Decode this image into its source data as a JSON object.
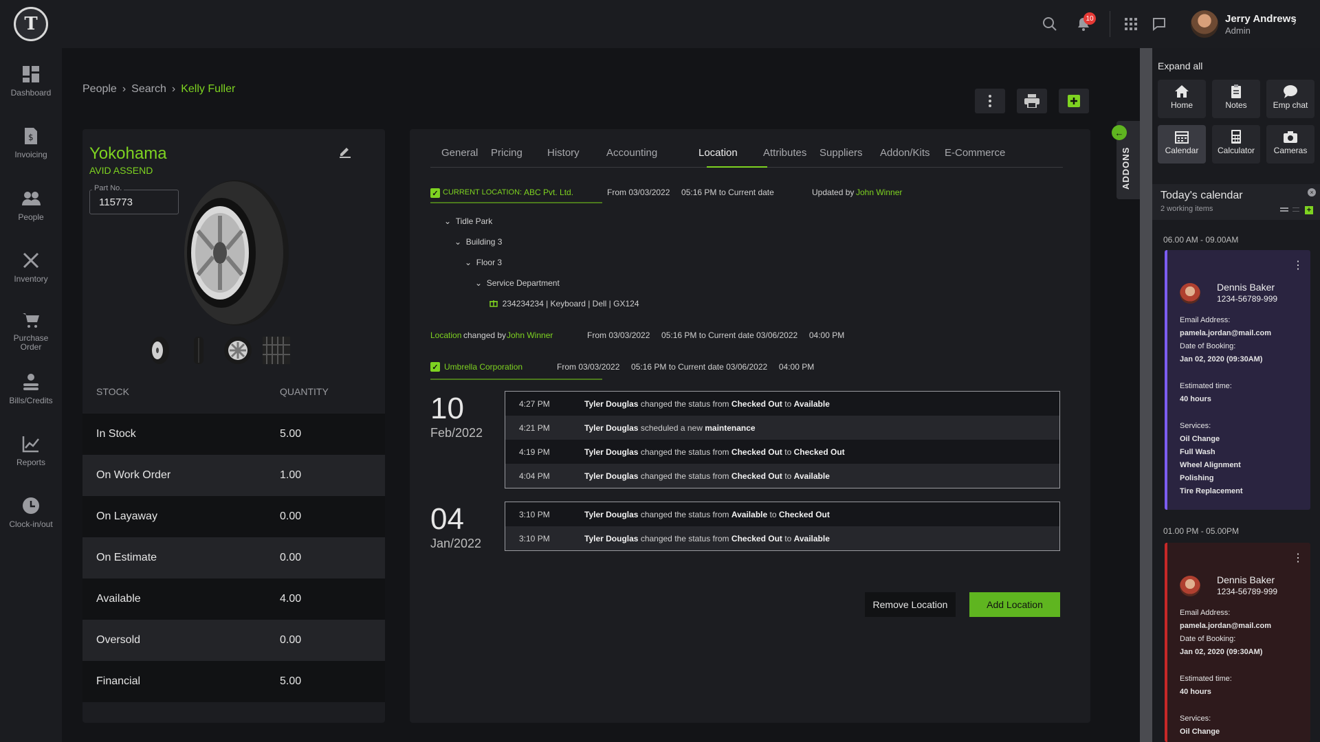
{
  "header": {
    "logo_text": "T",
    "notification_count": "10",
    "user": {
      "name": "Jerry Andrews",
      "role": "Admin"
    }
  },
  "sidebar": {
    "items": [
      {
        "label": "Dashboard",
        "icon": "dashboard-icon"
      },
      {
        "label": "Invoicing",
        "icon": "invoice-icon"
      },
      {
        "label": "People",
        "icon": "people-icon"
      },
      {
        "label": "Inventory",
        "icon": "tools-icon"
      },
      {
        "label": "Purchase Order",
        "icon": "cart-icon"
      },
      {
        "label": "Bills/Credits",
        "icon": "bills-icon"
      },
      {
        "label": "Reports",
        "icon": "chart-icon"
      },
      {
        "label": "Clock-in/out",
        "icon": "clock-icon"
      }
    ]
  },
  "breadcrumb": {
    "items": [
      "People",
      "Search",
      "Kelly Fuller"
    ]
  },
  "product": {
    "brand": "Yokohama",
    "model": "AVID ASSEND",
    "part_label": "Part No.",
    "part_no": "115773"
  },
  "stock": {
    "headers": {
      "stock": "STOCK",
      "quantity": "QUANTITY"
    },
    "rows": [
      {
        "label": "In Stock",
        "value": "5.00"
      },
      {
        "label": "On Work Order",
        "value": "1.00"
      },
      {
        "label": "On Layaway",
        "value": "0.00"
      },
      {
        "label": "On Estimate",
        "value": "0.00"
      },
      {
        "label": "Available",
        "value": "4.00"
      },
      {
        "label": "Oversold",
        "value": "0.00"
      },
      {
        "label": "Financial",
        "value": "5.00"
      }
    ]
  },
  "tabs": [
    "General",
    "Pricing",
    "History",
    "Accounting",
    "Location",
    "Attributes",
    "Suppliers",
    "Addon/Kits",
    "E-Commerce"
  ],
  "location": {
    "current_label": "CURRENT LOCATION:",
    "current_value": "ABC Pvt. Ltd.",
    "current_range": "From 03/03/2022     05:16 PM to Current date",
    "updated_prefix": "Updated by",
    "updated_by": "John Winner",
    "tree": [
      "Tidle Park",
      "Building 3",
      "Floor 3",
      "Service Department",
      "234234234 | Keyboard | Dell | GX124"
    ],
    "changed_link": "Location",
    "changed_mid": "changed by",
    "changed_by": "John Winner",
    "changed_range": "From 03/03/2022     05:16 PM to Current date 03/06/2022     04:00 PM",
    "second_name": "Umbrella Corporation",
    "second_range": "From 03/03/2022     05:16 PM to Current date 03/06/2022     04:00 PM"
  },
  "log_groups": [
    {
      "day": "10",
      "month": "Feb/2022",
      "rows": [
        {
          "time": "4:27 PM",
          "who": "Tyler Douglas",
          "mid": "changed the status from",
          "from": "Checked Out",
          "to_word": "to",
          "to": "Available"
        },
        {
          "time": "4:21 PM",
          "who": "Tyler Douglas",
          "mid": "scheduled a new",
          "from": "maintenance",
          "to_word": "",
          "to": ""
        },
        {
          "time": "4:19 PM",
          "who": "Tyler Douglas",
          "mid": "changed the status from",
          "from": "Checked Out",
          "to_word": "to",
          "to": "Checked Out"
        },
        {
          "time": "4:04 PM",
          "who": "Tyler Douglas",
          "mid": "changed the status from",
          "from": "Checked Out",
          "to_word": "to",
          "to": "Available"
        }
      ]
    },
    {
      "day": "04",
      "month": "Jan/2022",
      "rows": [
        {
          "time": "3:10 PM",
          "who": "Tyler Douglas",
          "mid": "changed the status from",
          "from": "Available",
          "to_word": "to",
          "to": "Checked Out"
        },
        {
          "time": "3:10 PM",
          "who": "Tyler Douglas",
          "mid": "changed the status from",
          "from": "Checked Out",
          "to_word": "to",
          "to": "Available"
        }
      ]
    }
  ],
  "buttons": {
    "remove": "Remove Location",
    "add": "Add Location"
  },
  "addons": {
    "tab_label": "ADDONS",
    "expand": "Expand all",
    "quick": [
      "Home",
      "Notes",
      "Emp chat",
      "Calendar",
      "Calculator",
      "Cameras"
    ],
    "calendar_title": "Today's calendar",
    "calendar_sub": "2 working items",
    "slots": [
      {
        "time": "06.00 AM - 09.00AM",
        "name": "Dennis Baker",
        "phone": "1234-56789-999",
        "email_label": "Email Address:",
        "email": "pamela.jordan@mail.com",
        "booking_label": "Date of Booking:",
        "booking": "Jan 02, 2020 (09:30AM)",
        "est_label": "Estimated time:",
        "est": "40 hours",
        "services_label": "Services:",
        "services": [
          "Oil Change",
          "Full Wash",
          "Wheel Alignment",
          "Polishing",
          "Tire Replacement"
        ],
        "accent": "#7b5cf0",
        "bg": "#2a2440"
      },
      {
        "time": "01.00 PM - 05.00PM",
        "name": "Dennis Baker",
        "phone": "1234-56789-999",
        "email_label": "Email Address:",
        "email": "pamela.jordan@mail.com",
        "booking_label": "Date of Booking:",
        "booking": "Jan 02, 2020 (09:30AM)",
        "est_label": "Estimated time:",
        "est": "40 hours",
        "services_label": "Services:",
        "services": [
          "Oil Change"
        ],
        "accent": "#c62828",
        "bg": "#2e1a1c"
      }
    ]
  },
  "colors": {
    "accent": "#7ed321",
    "background": "#131417",
    "panel": "#1c1d21"
  }
}
